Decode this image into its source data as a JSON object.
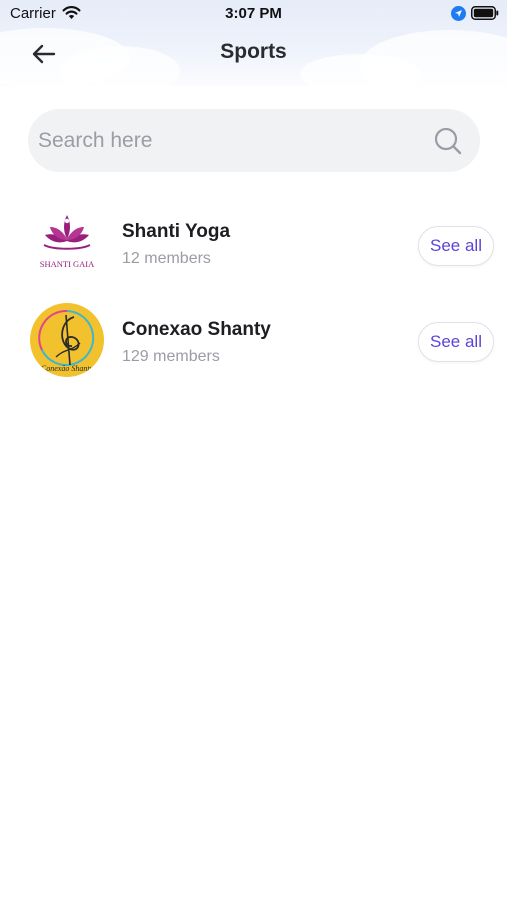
{
  "status_bar": {
    "carrier": "Carrier",
    "time": "3:07 PM"
  },
  "header": {
    "title": "Sports",
    "back_icon": "arrow-left-icon"
  },
  "search": {
    "placeholder": "Search here",
    "value": "",
    "icon": "search-icon"
  },
  "groups": [
    {
      "name": "Shanti Yoga",
      "members": "12 members",
      "see_all_label": "See all",
      "logo_text": "SHANTI GAIA"
    },
    {
      "name": "Conexao Shanty",
      "members": "129 members",
      "see_all_label": "See all",
      "logo_text": "Conexão Shanty"
    }
  ],
  "colors": {
    "accent": "#5b45d8",
    "muted_text": "#9a9ca6",
    "search_bg": "#f1f2f4",
    "logo_magenta": "#9a1e7c",
    "logo_yellow": "#f2c12e"
  }
}
